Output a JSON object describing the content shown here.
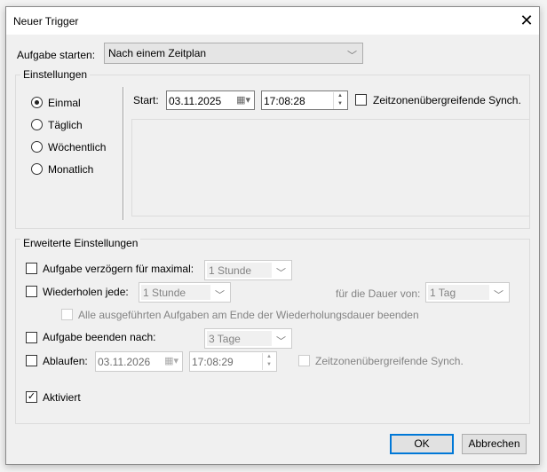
{
  "window": {
    "title": "Neuer Trigger",
    "close_icon": "close-icon"
  },
  "start_task": {
    "label": "Aufgabe starten:",
    "value": "Nach einem Zeitplan"
  },
  "settings": {
    "legend": "Einstellungen",
    "options": [
      {
        "label": "Einmal",
        "selected": true
      },
      {
        "label": "Täglich",
        "selected": false
      },
      {
        "label": "Wöchentlich",
        "selected": false
      },
      {
        "label": "Monatlich",
        "selected": false
      }
    ],
    "start_label": "Start:",
    "start_date": "03.11.2025",
    "start_time": "17:08:28",
    "sync_label": "Zeitzonenübergreifende Synch.",
    "sync_checked": false
  },
  "advanced": {
    "legend": "Erweiterte Einstellungen",
    "delay": {
      "label": "Aufgabe verzögern für maximal:",
      "value": "1 Stunde",
      "checked": false
    },
    "repeat": {
      "label": "Wiederholen jede:",
      "value": "1 Stunde",
      "checked": false,
      "duration_label": "für die Dauer von:",
      "duration_value": "1 Tag"
    },
    "stop_all": {
      "label": "Alle ausgeführten Aufgaben am Ende der Wiederholungsdauer beenden",
      "checked": false
    },
    "stop_after": {
      "label": "Aufgabe beenden nach:",
      "value": "3 Tage",
      "checked": false
    },
    "expire": {
      "label": "Ablaufen:",
      "date": "03.11.2026",
      "time": "17:08:29",
      "checked": false,
      "sync_label": "Zeitzonenübergreifende Synch."
    },
    "enabled": {
      "label": "Aktiviert",
      "checked": true
    }
  },
  "buttons": {
    "ok": "OK",
    "cancel": "Abbrechen"
  }
}
